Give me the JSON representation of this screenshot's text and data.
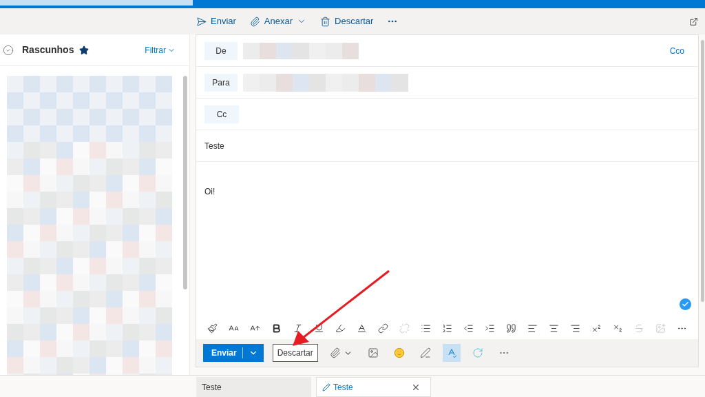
{
  "toolbar": {
    "actions": [
      {
        "kind": "send",
        "label": "Enviar",
        "dropdown": false
      },
      {
        "kind": "attach",
        "label": "Anexar",
        "dropdown": true
      },
      {
        "kind": "discard",
        "label": "Descartar",
        "dropdown": false
      }
    ]
  },
  "folder": {
    "title": "Rascunhos",
    "favorite": true,
    "filter": "Filtrar"
  },
  "compose": {
    "from_label": "De",
    "to_label": "Para",
    "cc_label": "Cc",
    "bcc_link": "Cco",
    "subject": "Teste",
    "body": "Oi!",
    "format_tools": [
      {
        "kind": "format-painter",
        "disabled": false
      },
      {
        "kind": "font-size",
        "disabled": false
      },
      {
        "kind": "grow-font",
        "disabled": false
      },
      {
        "kind": "bold",
        "disabled": false
      },
      {
        "kind": "italic",
        "disabled": false
      },
      {
        "kind": "underline",
        "disabled": false
      },
      {
        "kind": "highlight",
        "disabled": false
      },
      {
        "kind": "font-color",
        "disabled": false
      },
      {
        "kind": "link",
        "disabled": false
      },
      {
        "kind": "unlink",
        "disabled": true
      },
      {
        "kind": "bullets",
        "disabled": false
      },
      {
        "kind": "numbering",
        "disabled": false
      },
      {
        "kind": "outdent",
        "disabled": false
      },
      {
        "kind": "indent",
        "disabled": false
      },
      {
        "kind": "quote",
        "disabled": false
      },
      {
        "kind": "align-left",
        "disabled": false
      },
      {
        "kind": "align-center",
        "disabled": false
      },
      {
        "kind": "align-right",
        "disabled": false
      },
      {
        "kind": "superscript",
        "disabled": false
      },
      {
        "kind": "subscript",
        "disabled": false
      },
      {
        "kind": "strikethrough",
        "disabled": true
      },
      {
        "kind": "insert-image",
        "disabled": true
      },
      {
        "kind": "more",
        "disabled": false
      }
    ],
    "send": "Enviar",
    "discard": "Descartar",
    "action_tools": [
      {
        "kind": "attach",
        "selected": false
      },
      {
        "kind": "picture",
        "selected": false
      },
      {
        "kind": "emoji",
        "selected": false
      },
      {
        "kind": "signature",
        "selected": false
      },
      {
        "kind": "editor",
        "selected": true
      },
      {
        "kind": "loop",
        "selected": false
      },
      {
        "kind": "more",
        "selected": false
      }
    ]
  },
  "tabs": [
    {
      "label": "Teste",
      "selected": false
    },
    {
      "label": "Teste",
      "selected": true
    }
  ]
}
